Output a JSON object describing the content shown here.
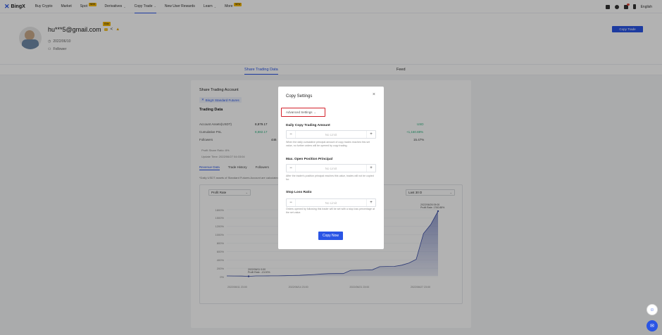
{
  "nav": {
    "brand": "BingX",
    "items": [
      {
        "label": "Buy Crypto",
        "badge": "",
        "chevron": false
      },
      {
        "label": "Market",
        "badge": "",
        "chevron": false
      },
      {
        "label": "Spot",
        "badge": "NEW",
        "chevron": false
      },
      {
        "label": "Derivatives",
        "badge": "",
        "chevron": true
      },
      {
        "label": "Copy Trade",
        "badge": "",
        "chevron": true,
        "active": true
      },
      {
        "label": "New User Rewards",
        "badge": "",
        "chevron": false
      },
      {
        "label": "Learn",
        "badge": "",
        "chevron": true
      },
      {
        "label": "More",
        "badge": "NEW",
        "chevron": false
      }
    ],
    "language": "English",
    "notification_count": "1"
  },
  "profile": {
    "email": "hu***5@gmail.com",
    "tag": "Elite",
    "joined": "2022/06/10",
    "followers": "Follower"
  },
  "copy_trade_button": "Copy Trade",
  "page_tabs": [
    "Share Trading Data",
    "Feed"
  ],
  "trading": {
    "section_title": "Share Trading Account",
    "account_chip": "BingX Standard Futures",
    "data_title": "Trading Data",
    "stats": [
      {
        "label": "Account Assets(USDT)",
        "value": "8,879.17",
        "right": "USD",
        "right_color": "#2fb380"
      },
      {
        "label": "Cumulative PnL",
        "value": "8,882.17",
        "right": "+1,160.88%",
        "right_color": "#2fb380"
      },
      {
        "label": "Followers",
        "value": "446",
        "right": "15.47%",
        "right_color": "#444444"
      }
    ],
    "notes": [
      "Profit Share Ratio: 8%",
      "Update Time: 2022/06/27 04:03:04"
    ],
    "tabs": [
      "Revenue Data",
      "Trade History",
      "Followers"
    ],
    "disclaimer": "*Daily USDT assets of Standard Futures Account are calculated"
  },
  "chart_ui": {
    "metric_select": "Profit Rate",
    "period_select": "Last 30 D",
    "annotation_low": [
      "2022/06/11 0:00",
      "Profit Rate: -13.00%"
    ],
    "annotation_high": [
      "2022/06/26 09:00",
      "Profit Rate: 1760.88%"
    ]
  },
  "chart_data": {
    "type": "area",
    "y_ticks": [
      "1800%",
      "1500%",
      "1200%",
      "1000%",
      "800%",
      "600%",
      "400%",
      "200%",
      "0%"
    ],
    "x_ticks": [
      "2022/06/11 23:00",
      "2022/06/14 23:00",
      "2022/06/21 23:00",
      "2022/06/27 23:00"
    ],
    "x": [
      0,
      1,
      2,
      3,
      4,
      5,
      6,
      7,
      8,
      9,
      10,
      11,
      12,
      13,
      14,
      15,
      16,
      17,
      18,
      19,
      20,
      21,
      22,
      23,
      24,
      25,
      26,
      27,
      28,
      29
    ],
    "values": [
      0,
      -2,
      -5,
      -13,
      0,
      0,
      1,
      2,
      5,
      10,
      15,
      25,
      35,
      50,
      60,
      62,
      63,
      150,
      155,
      160,
      165,
      250,
      255,
      258,
      290,
      350,
      450,
      1150,
      1400,
      1760.88
    ],
    "ylim": [
      -20,
      1800
    ],
    "color": "#3b4ea6"
  },
  "modal": {
    "title": "Copy Settings",
    "advanced_label": "Advanced Settings",
    "fields": [
      {
        "label": "Daily Copy Trading Amount",
        "placeholder": "No Limit",
        "help": "When the daily cumulative principal amount of copy trades reaches this set value, no further orders will be opened by copy trading."
      },
      {
        "label": "Max. Open Position Principal",
        "placeholder": "No Limit",
        "help": "After the trader's position principal reaches this value, trades will not be copied for."
      },
      {
        "label": "Stop Loss Ratio",
        "placeholder": "No Limit",
        "help": "Orders opened by following this trader will be set with a stop loss percentage at the set value."
      }
    ],
    "copy_now": "Copy Now"
  }
}
